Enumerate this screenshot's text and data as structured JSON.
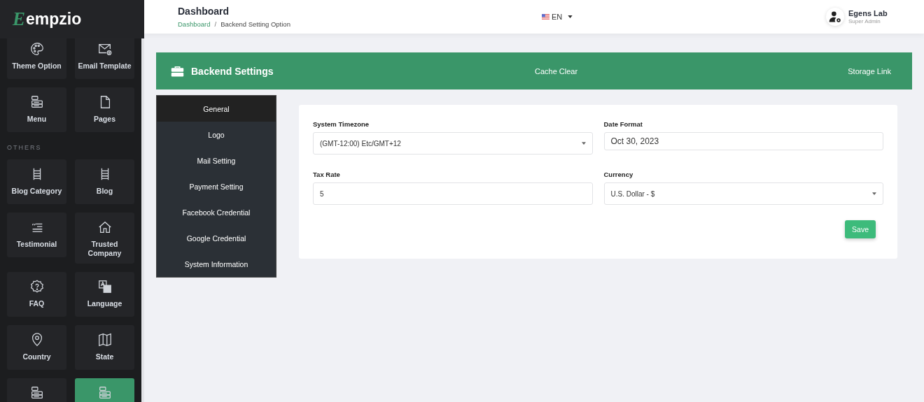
{
  "sidebar": {
    "logo": {
      "mark": "E",
      "text": "empzio"
    },
    "sections": [
      {
        "items": [
          {
            "label": "Theme Option",
            "selected": false
          },
          {
            "label": "Email Template",
            "selected": false
          },
          {
            "label": "Menu",
            "selected": false
          },
          {
            "label": "Pages",
            "selected": false
          }
        ]
      },
      {
        "title": "OTHERS",
        "items": [
          {
            "label": "Blog Category",
            "selected": false
          },
          {
            "label": "Blog",
            "selected": false
          },
          {
            "label": "Testimonial",
            "selected": false
          },
          {
            "label": "Trusted Company",
            "selected": false
          },
          {
            "label": "FAQ",
            "selected": false
          },
          {
            "label": "Language",
            "selected": false
          },
          {
            "label": "Country",
            "selected": false
          },
          {
            "label": "State",
            "selected": false
          },
          {
            "selected": false
          },
          {
            "selected": true
          }
        ]
      }
    ]
  },
  "header": {
    "title": "Dashboard",
    "breadcrumb": [
      {
        "label": "Dashboard",
        "link": true
      },
      {
        "label": "Backend Setting Option",
        "link": false
      }
    ],
    "breadcrumb_separator": "/",
    "language": "EN",
    "user": {
      "name": "Egens Lab",
      "role": "Super Admin"
    }
  },
  "settings_bar": {
    "title": "Backend Settings",
    "actions": [
      "Cache Clear",
      "Storage Link"
    ]
  },
  "settings_tabs": [
    {
      "label": "General",
      "selected": true
    },
    {
      "label": "Logo",
      "selected": false
    },
    {
      "label": "Mail Setting",
      "selected": false
    },
    {
      "label": "Payment Setting",
      "selected": false
    },
    {
      "label": "Facebook Credential",
      "selected": false
    },
    {
      "label": "Google Credential",
      "selected": false
    },
    {
      "label": "System Information",
      "selected": false
    }
  ],
  "form": {
    "fields": [
      {
        "label": "System Timezone",
        "kind": "select",
        "value": "(GMT-12:00) Etc/GMT+12"
      },
      {
        "label": "Date Format",
        "kind": "date",
        "value": "Oct 30, 2023"
      },
      {
        "label": "Tax Rate",
        "kind": "text",
        "value": "5"
      },
      {
        "label": "Currency",
        "kind": "select",
        "value": "U.S. Dollar - $"
      }
    ],
    "submit": "Save"
  }
}
